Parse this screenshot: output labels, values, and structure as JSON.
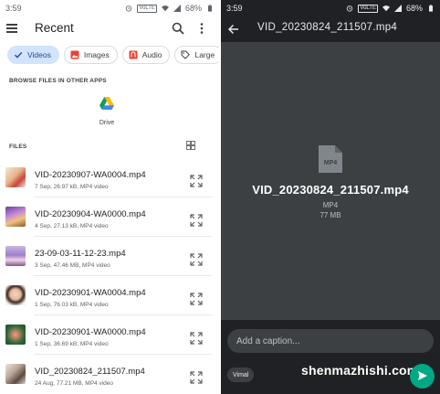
{
  "left": {
    "status_time": "3:59",
    "status_network": "VoLTE",
    "status_battery": "68%",
    "app_title": "Recent",
    "chips": [
      {
        "label": "Videos",
        "icon": "check-icon",
        "selected": true
      },
      {
        "label": "Images",
        "icon": "image-icon",
        "selected": false
      },
      {
        "label": "Audio",
        "icon": "audio-icon",
        "selected": false
      },
      {
        "label": "Large",
        "icon": "tag-icon",
        "selected": false
      }
    ],
    "browse_label": "BROWSE FILES IN OTHER APPS",
    "drive_label": "Drive",
    "files_label": "FILES",
    "files": [
      {
        "name": "VID-20230907-WA0004.mp4",
        "meta": "7 Sep, 26.97 kB, MP4 video"
      },
      {
        "name": "VID-20230904-WA0000.mp4",
        "meta": "4 Sep, 27.13 kB, MP4 video"
      },
      {
        "name": "23-09-03-11-12-23.mp4",
        "meta": "3 Sep, 47.46 MB, MP4 video"
      },
      {
        "name": "VID-20230901-WA0004.mp4",
        "meta": "1 Sep, 76.03 kB, MP4 video"
      },
      {
        "name": "VID-20230901-WA0000.mp4",
        "meta": "1 Sep, 36.69 kB, MP4 video"
      },
      {
        "name": "VID_20230824_211507.mp4",
        "meta": "24 Aug, 77.21 MB, MP4 video"
      }
    ]
  },
  "right": {
    "status_time": "3:59",
    "status_network": "VoLTE",
    "status_battery": "68%",
    "title": "VID_20230824_211507.mp4",
    "file_icon_label": "MP4",
    "file_name": "VID_20230824_211507.mp4",
    "file_type": "MP4",
    "file_size": "77 MB",
    "caption_placeholder": "Add a caption...",
    "recipient": "Vimal",
    "watermark": "shenmazhishi.com"
  },
  "colors": {
    "chip_selected_bg": "#d2e3fc",
    "chip_selected_text": "#174ea6",
    "dark_bg": "#202124",
    "preview_bg": "#3c4043",
    "send_green": "#00a884"
  }
}
